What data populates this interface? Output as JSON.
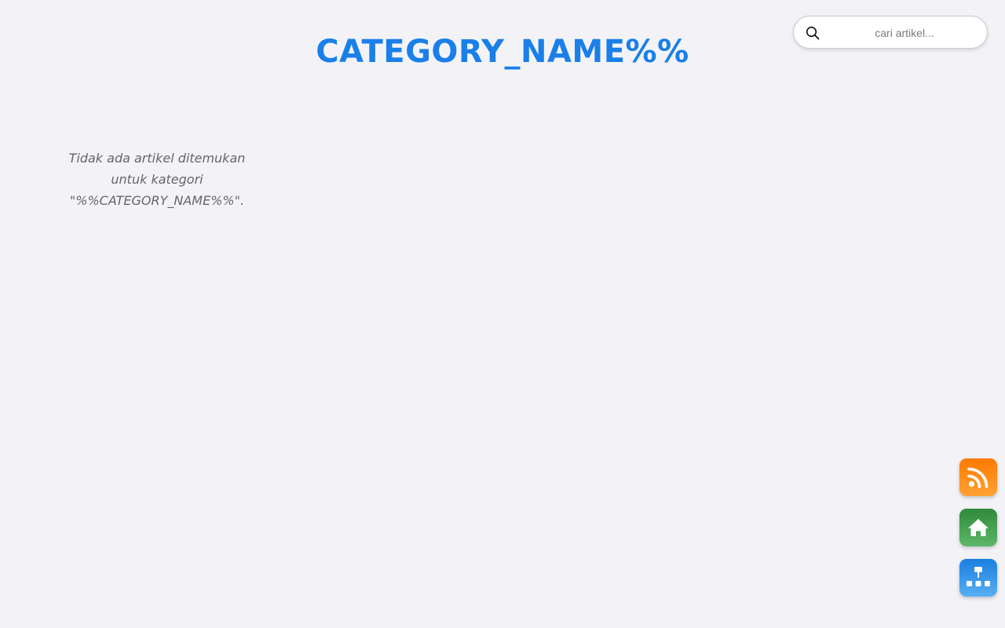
{
  "header": {
    "title": "CATEGORY_NAME%%"
  },
  "search": {
    "placeholder": "cari artikel...",
    "value": "",
    "icon": "search-icon"
  },
  "main": {
    "empty_lines": [
      "Tidak ada artikel ditemukan",
      "untuk kategori",
      "\"%%CATEGORY_NAME%%\"."
    ]
  },
  "floating_buttons": [
    {
      "name": "rss-button",
      "icon": "rss-icon",
      "color": "#ff8c1a"
    },
    {
      "name": "home-button",
      "icon": "home-icon",
      "color": "#43a04f"
    },
    {
      "name": "sitemap-button",
      "icon": "sitemap-icon",
      "color": "#2a8ee8"
    }
  ],
  "colors": {
    "background": "#f3f3f7",
    "title": "#1a7fe8",
    "message": "#666666"
  }
}
